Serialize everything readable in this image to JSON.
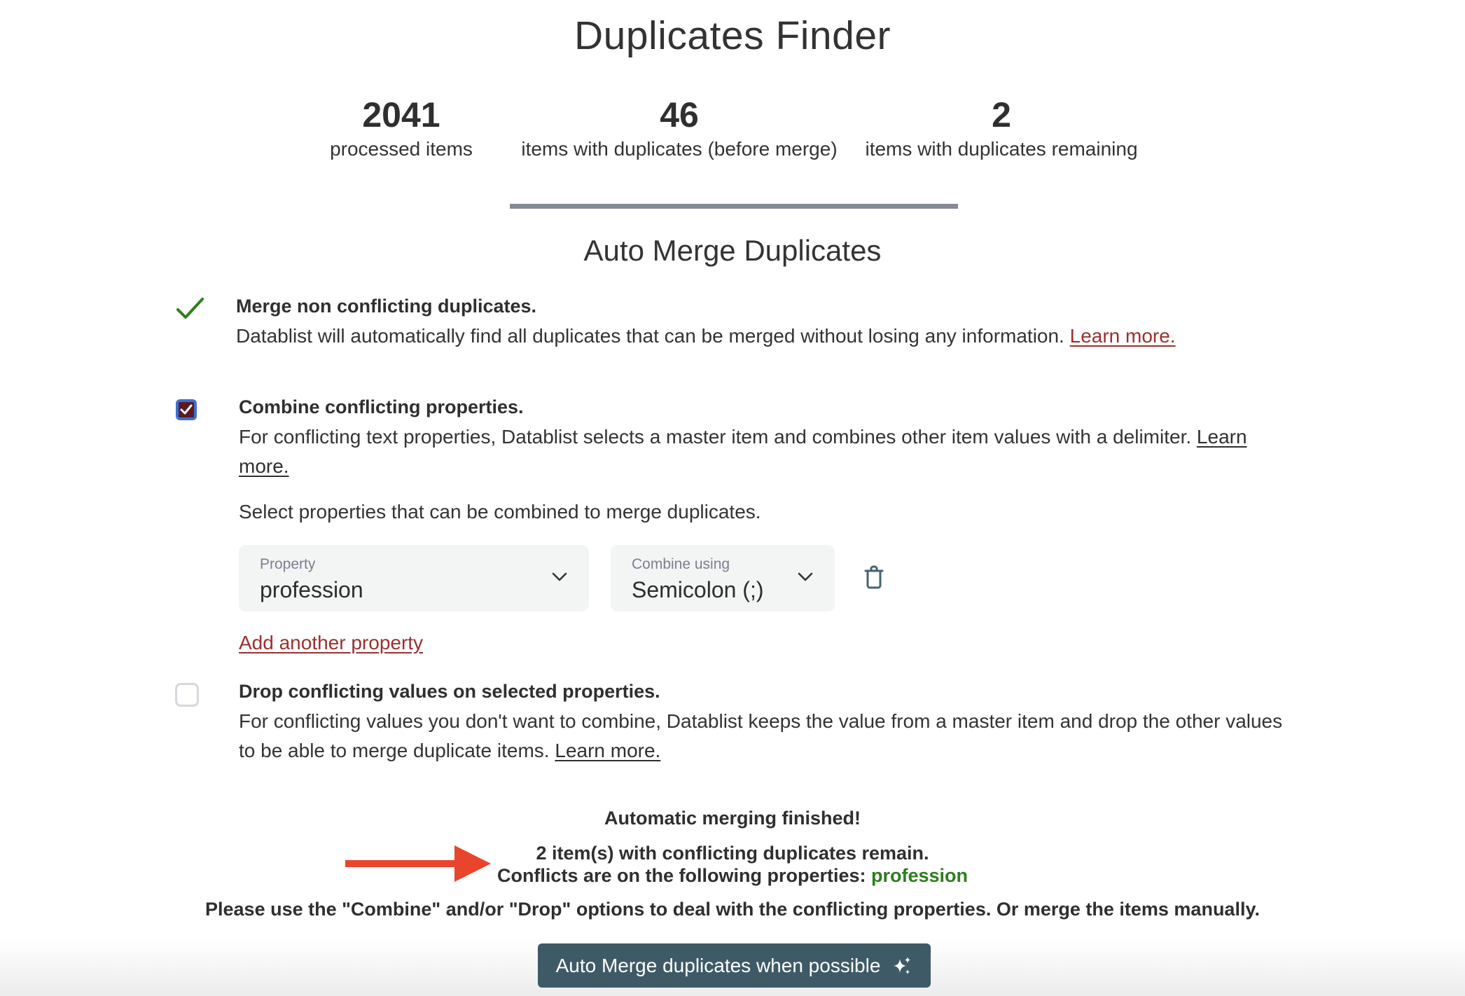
{
  "header": {
    "title": "Duplicates Finder"
  },
  "stats": [
    {
      "value": "2041",
      "label": "processed items"
    },
    {
      "value": "46",
      "label": "items with duplicates (before merge)"
    },
    {
      "value": "2",
      "label": "items with duplicates remaining"
    }
  ],
  "auto_merge": {
    "title": "Auto Merge Duplicates",
    "merge_non_conflicting": {
      "title": "Merge non conflicting duplicates.",
      "description": "Datablist will automatically find all duplicates that can be merged without losing any information.",
      "learn_more": "Learn more.",
      "icon": "check-icon"
    },
    "combine_conflicting": {
      "checked": true,
      "title": "Combine conflicting properties.",
      "description": "For conflicting text properties, Datablist selects a master item and combines other item values with a delimiter.",
      "learn_more": "Learn more.",
      "select_hint": "Select properties that can be combined to merge duplicates.",
      "property_select": {
        "label": "Property",
        "value": "profession"
      },
      "combine_select": {
        "label": "Combine using",
        "value": "Semicolon (;)"
      },
      "delete_icon": "trash-icon",
      "add_property": "Add another property"
    },
    "drop_conflicting": {
      "checked": false,
      "title": "Drop conflicting values on selected properties.",
      "description": "For conflicting values you don't want to combine, Datablist keeps the value from a master item and drop the other values to be able to merge duplicate items.",
      "learn_more": "Learn more."
    }
  },
  "result": {
    "finished": "Automatic merging finished!",
    "remaining": "2 item(s) with conflicting duplicates remain.",
    "conflicts_prefix": "Conflicts are on the following properties:",
    "conflict_property": "profession",
    "instruction": "Please use the \"Combine\" and/or \"Drop\" options to deal with the conflicting properties. Or merge the items manually."
  },
  "button": {
    "label": "Auto Merge duplicates when possible",
    "icon": "sparkles-icon"
  },
  "colors": {
    "accent_link": "#9c2f2f",
    "success": "#2e7d1e",
    "button_bg": "#3e5a67",
    "arrow": "#e8452c"
  }
}
